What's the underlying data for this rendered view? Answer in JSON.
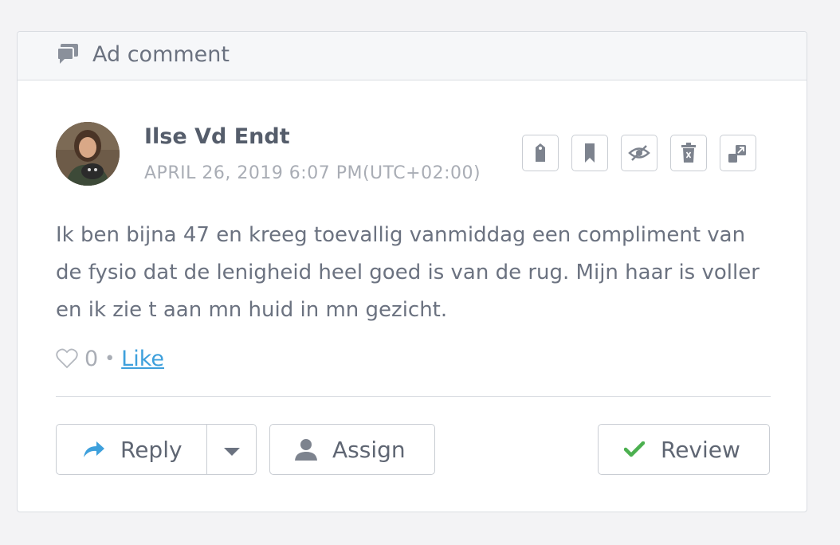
{
  "header": {
    "title": "Ad comment",
    "icon": "comments-icon"
  },
  "comment": {
    "author": "Ilse Vd Endt",
    "timestamp": "APRIL 26, 2019 6:07 PM(UTC+02:00)",
    "text": "Ik ben bijna 47 en kreeg toevallig vanmiddag een compliment van de fysio dat de lenigheid heel goed is van de rug. Mijn haar is voller en ik zie t aan mn huid in mn gezicht.",
    "like_count": "0",
    "like_separator": "•",
    "like_label": "Like"
  },
  "actions": {
    "icons": [
      "tag-icon",
      "bookmark-icon",
      "hide-icon",
      "delete-icon",
      "expand-icon"
    ]
  },
  "buttons": {
    "reply_label": "Reply",
    "assign_label": "Assign",
    "review_label": "Review"
  },
  "colors": {
    "link": "#3ea0dc",
    "reply_arrow": "#3ea0dc",
    "review_check": "#4cb050",
    "text": "#6b7280"
  }
}
